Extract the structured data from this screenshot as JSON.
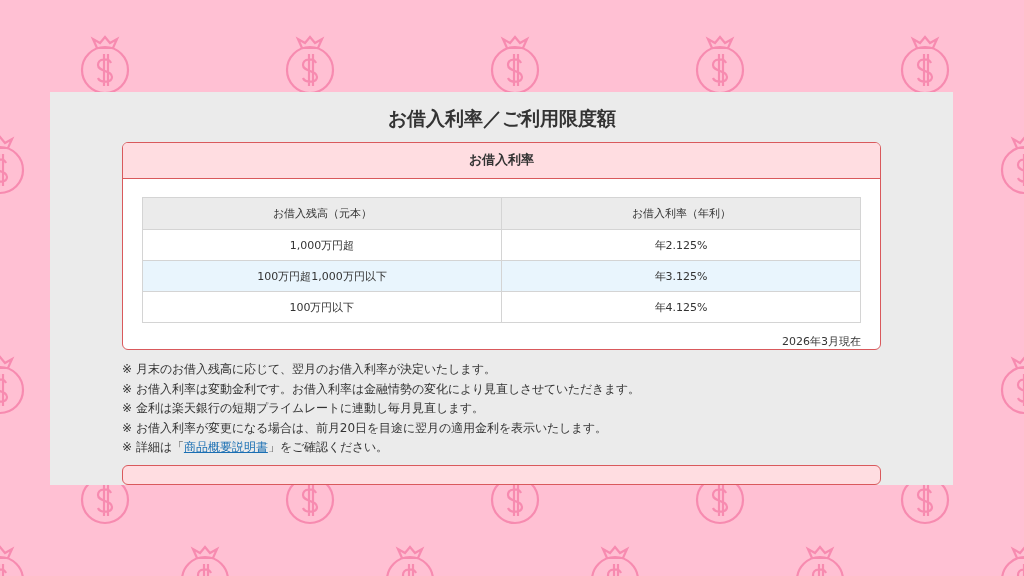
{
  "title": "お借入利率／ご利用限度額",
  "rate_card": {
    "heading": "お借入利率",
    "table": {
      "columns": [
        "お借入残高（元本）",
        "お借入利率（年利）"
      ],
      "rows": [
        {
          "cells": [
            "1,000万円超",
            "年2.125%"
          ],
          "highlighted": false
        },
        {
          "cells": [
            "100万円超1,000万円以下",
            "年3.125%"
          ],
          "highlighted": true
        },
        {
          "cells": [
            "100万円以下",
            "年4.125%"
          ],
          "highlighted": false
        }
      ]
    },
    "as_of": "2026年3月現在"
  },
  "notes": [
    {
      "kind": "text",
      "text": "※ 月末のお借入残高に応じて、翌月のお借入利率が決定いたします。"
    },
    {
      "kind": "text",
      "text": "※ お借入利率は変動金利です。お借入利率は金融情勢の変化により見直しさせていただきます。"
    },
    {
      "kind": "text",
      "text": "※ 金利は楽天銀行の短期プライムレートに連動し毎月見直します。"
    },
    {
      "kind": "text",
      "text": "※ お借入利率が変更になる場合は、前月20日を目途に翌月の適用金利を表示いたします。"
    },
    {
      "kind": "link",
      "before": "※ 詳細は「",
      "link": "商品概要説明書",
      "after": "」をご確認ください。"
    }
  ]
}
